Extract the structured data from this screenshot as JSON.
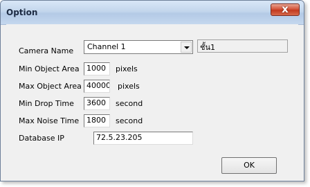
{
  "window": {
    "title": "Option",
    "close_glyph": "x"
  },
  "form": {
    "camera_name_label": "Camera Name",
    "camera_name_value": "Channel 1",
    "camera_alias_value": "ชั้น1",
    "min_object_area_label": "Min Object Area",
    "min_object_area_value": "1000",
    "min_object_area_unit": "pixels",
    "max_object_area_label": "Max Object Area",
    "max_object_area_value": "40000",
    "max_object_area_unit": "pixels",
    "min_drop_time_label": "Min Drop Time",
    "min_drop_time_value": "3600",
    "min_drop_time_unit": "second",
    "max_noise_time_label": "Max Noise Time",
    "max_noise_time_value": "1800",
    "max_noise_time_unit": "second",
    "database_ip_label": "Database IP",
    "database_ip_value": "72.5.23.205"
  },
  "buttons": {
    "ok_label": "OK"
  }
}
